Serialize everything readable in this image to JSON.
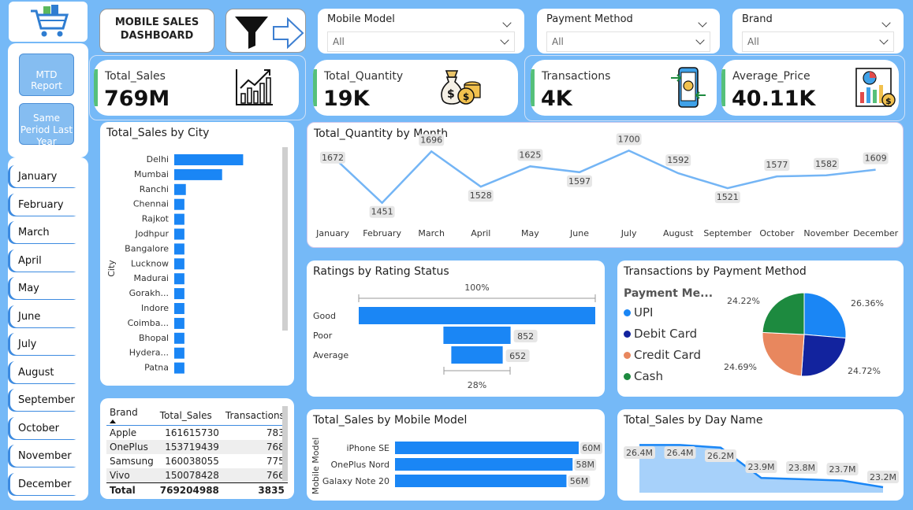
{
  "header": {
    "title": "MOBILE SALES DASHBOARD"
  },
  "nav": {
    "mtd_label": "MTD Report",
    "spl_label": "Same Period Last Year"
  },
  "months": [
    "January",
    "February",
    "March",
    "April",
    "May",
    "June",
    "July",
    "August",
    "September",
    "October",
    "November",
    "December"
  ],
  "filters": [
    {
      "label": "Mobile Model",
      "value": "All"
    },
    {
      "label": "Payment Method",
      "value": "All"
    },
    {
      "label": "Brand",
      "value": "All"
    }
  ],
  "kpis": [
    {
      "label": "Total_Sales",
      "value": "769M",
      "icon": "growth-chart-icon"
    },
    {
      "label": "Total_Quantity",
      "value": "19K",
      "icon": "money-bag-icon"
    },
    {
      "label": "Transactions",
      "value": "4K",
      "icon": "mobile-payment-icon"
    },
    {
      "label": "Average_Price",
      "value": "40.11K",
      "icon": "report-chart-icon"
    }
  ],
  "colors": {
    "background": "#75b9f7",
    "bar": "#1a86f5",
    "line": "#74b5f5",
    "kpi_accent": "#56c07a",
    "upi": "#1a86f5",
    "debit": "#12239e",
    "credit": "#e8875e",
    "cash": "#1d8a3f"
  },
  "chart_data": [
    {
      "type": "bar",
      "title": "Total_Sales by City",
      "ylabel": "City",
      "categories": [
        "Delhi",
        "Mumbai",
        "Ranchi",
        "Chennai",
        "Rajkot",
        "Jodhpur",
        "Bangalore",
        "Lucknow",
        "Madurai",
        "Gorakh...",
        "Indore",
        "Coimba...",
        "Bhopal",
        "Hydera...",
        "Patna"
      ],
      "values": [
        95,
        66,
        16,
        14,
        14,
        14,
        14,
        14,
        14,
        14,
        14,
        14,
        14,
        14,
        14
      ]
    },
    {
      "type": "line",
      "title": "Total_Quantity by Month",
      "categories": [
        "January",
        "February",
        "March",
        "April",
        "May",
        "June",
        "July",
        "August",
        "September",
        "October",
        "November",
        "December"
      ],
      "values": [
        1672,
        1451,
        1696,
        1528,
        1625,
        1597,
        1700,
        1592,
        1521,
        1577,
        1582,
        1609
      ]
    },
    {
      "type": "bar",
      "title": "Ratings by Rating Status",
      "categories": [
        "Good",
        "Poor",
        "Average"
      ],
      "values": [
        3000,
        852,
        652
      ],
      "top_annotation": "100%",
      "bottom_annotation": "28%"
    },
    {
      "type": "pie",
      "title": "Transactions by Payment Method",
      "legend_title": "Payment Me...",
      "categories": [
        "UPI",
        "Debit Card",
        "Credit Card",
        "Cash"
      ],
      "labels": [
        "26.36%",
        "24.72%",
        "24.69%",
        "24.22%"
      ],
      "values": [
        26.36,
        24.72,
        24.69,
        24.22
      ]
    },
    {
      "type": "bar",
      "title": "Total_Sales by Mobile Model",
      "ylabel": "Mobile Model",
      "categories": [
        "iPhone SE",
        "OnePlus Nord",
        "Galaxy Note 20"
      ],
      "values": [
        60,
        58,
        56
      ],
      "labels": [
        "60M",
        "58M",
        "56M"
      ]
    },
    {
      "type": "area",
      "title": "Total_Sales by Day Name",
      "values": [
        26.4,
        26.4,
        26.2,
        23.9,
        23.8,
        23.7,
        23.2
      ],
      "labels": [
        "26.4M",
        "26.4M",
        "26.2M",
        "23.9M",
        "23.8M",
        "23.7M",
        "23.2M"
      ]
    },
    {
      "type": "table",
      "columns": [
        "Brand",
        "Total_Sales",
        "Transactions"
      ],
      "rows": [
        [
          "Apple",
          "161615730",
          "783"
        ],
        [
          "OnePlus",
          "153719439",
          "768"
        ],
        [
          "Samsung",
          "160038055",
          "775"
        ],
        [
          "Vivo",
          "150078428",
          "766"
        ]
      ],
      "total": [
        "Total",
        "769204988",
        "3835"
      ]
    }
  ]
}
